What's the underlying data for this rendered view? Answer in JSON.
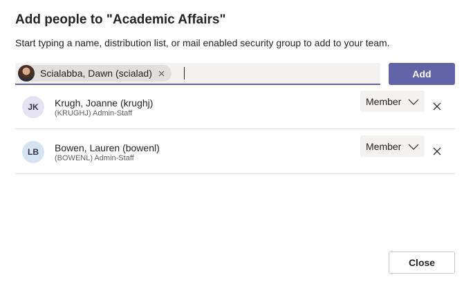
{
  "dialog": {
    "title": "Add people to \"Academic Affairs\"",
    "subtitle": "Start typing a name, distribution list, or mail enabled security group to add to your team."
  },
  "picker": {
    "chip_label": "Scialabba, Dawn (scialad)",
    "chip_remove_icon": "close-icon",
    "input_value": ""
  },
  "actions": {
    "add_label": "Add",
    "close_label": "Close"
  },
  "members": [
    {
      "initials": "JK",
      "name": "Krugh, Joanne (krughj)",
      "meta": "(KRUGHJ) Admin-Staff",
      "role": "Member",
      "avatar_color": "#e5e2f2"
    },
    {
      "initials": "LB",
      "name": "Bowen, Lauren (bowenl)",
      "meta": "(BOWENL) Admin-Staff",
      "role": "Member",
      "avatar_color": "#d6e3f1"
    }
  ],
  "colors": {
    "accent": "#6264a7",
    "input_bg": "#f3f2f1",
    "divider": "#e1dfdd"
  }
}
